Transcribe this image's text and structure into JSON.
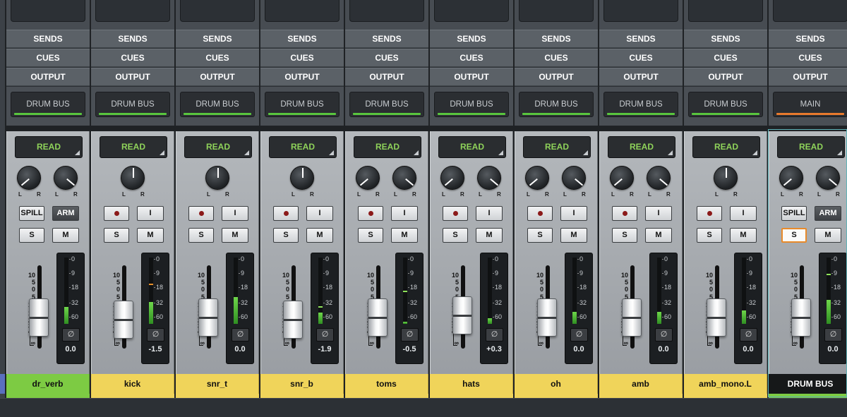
{
  "strips": [
    {
      "name": "dr_verb",
      "name_color": "green",
      "output": "DRUM BUS",
      "output_led": "green",
      "automation": "READ",
      "pan": "stereo",
      "top_buttons": [
        "SPILL",
        "ARM"
      ],
      "solo": "S",
      "mute": "M",
      "volume": "0.0",
      "meter": [
        0.25,
        0.0
      ],
      "fader": 0.62
    },
    {
      "name": "kick",
      "name_color": "yellow",
      "output": "DRUM BUS",
      "output_led": "green",
      "automation": "READ",
      "pan": "mono",
      "top_buttons": [
        "●",
        "I"
      ],
      "solo": "S",
      "mute": "M",
      "volume": "-1.5",
      "meter": [
        0.33,
        0.58
      ],
      "fader": 0.6
    },
    {
      "name": "snr_t",
      "name_color": "yellow",
      "output": "DRUM BUS",
      "output_led": "green",
      "automation": "READ",
      "pan": "mono",
      "top_buttons": [
        "●",
        "I"
      ],
      "solo": "S",
      "mute": "M",
      "volume": "0.0",
      "meter": [
        0.4,
        0.0
      ],
      "fader": 0.62
    },
    {
      "name": "snr_b",
      "name_color": "yellow",
      "output": "DRUM BUS",
      "output_led": "green",
      "automation": "READ",
      "pan": "mono",
      "top_buttons": [
        "●",
        "I"
      ],
      "solo": "S",
      "mute": "M",
      "volume": "-1.9",
      "meter": [
        0.17,
        0.24
      ],
      "fader": 0.6
    },
    {
      "name": "toms",
      "name_color": "yellow",
      "output": "DRUM BUS",
      "output_led": "green",
      "automation": "READ",
      "pan": "stereo",
      "top_buttons": [
        "●",
        "I"
      ],
      "solo": "S",
      "mute": "M",
      "volume": "-0.5",
      "meter": [
        0.03,
        0.48
      ],
      "fader": 0.62
    },
    {
      "name": "hats",
      "name_color": "yellow",
      "output": "DRUM BUS",
      "output_led": "green",
      "automation": "READ",
      "pan": "stereo",
      "top_buttons": [
        "●",
        "I"
      ],
      "solo": "S",
      "mute": "M",
      "volume": "+0.3",
      "meter": [
        0.08,
        0.0
      ],
      "fader": 0.64
    },
    {
      "name": "oh",
      "name_color": "yellow",
      "output": "DRUM BUS",
      "output_led": "green",
      "automation": "READ",
      "pan": "stereo",
      "top_buttons": [
        "●",
        "I"
      ],
      "solo": "S",
      "mute": "M",
      "volume": "0.0",
      "meter": [
        0.18,
        0.0
      ],
      "fader": 0.62
    },
    {
      "name": "amb",
      "name_color": "yellow",
      "output": "DRUM BUS",
      "output_led": "green",
      "automation": "READ",
      "pan": "stereo",
      "top_buttons": [
        "●",
        "I"
      ],
      "solo": "S",
      "mute": "M",
      "volume": "0.0",
      "meter": [
        0.18,
        0.0
      ],
      "fader": 0.62
    },
    {
      "name": "amb_mono.L",
      "name_color": "yellow",
      "output": "DRUM BUS",
      "output_led": "green",
      "automation": "READ",
      "pan": "mono",
      "top_buttons": [
        "●",
        "I"
      ],
      "solo": "S",
      "mute": "M",
      "volume": "0.0",
      "meter": [
        0.2,
        0.0
      ],
      "fader": 0.62
    },
    {
      "name": "DRUM BUS",
      "name_color": "black",
      "output": "MAIN",
      "output_led": "orange",
      "automation": "READ",
      "pan": "stereo",
      "top_buttons": [
        "SPILL",
        "ARM"
      ],
      "solo": "S",
      "mute": "M",
      "solo_active": true,
      "volume": "0.0",
      "meter": [
        0.36,
        0.73
      ],
      "fader": 0.62
    }
  ],
  "row_labels": {
    "sends": "SENDS",
    "cues": "CUES",
    "output": "OUTPUT"
  },
  "pan_labels": {
    "left": "L",
    "right": "R"
  },
  "fader_scale": [
    "10",
    "5",
    "0",
    "5",
    "10",
    "15",
    "20",
    "30",
    "40",
    "∞"
  ],
  "meter_scale": [
    "0",
    "9",
    "18",
    "32",
    "60"
  ],
  "phase_symbol": "∅"
}
